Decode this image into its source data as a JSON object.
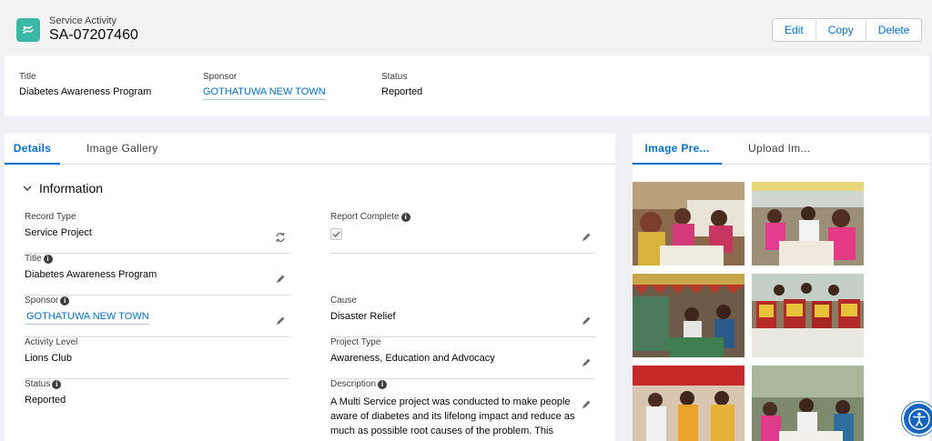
{
  "header": {
    "object_type": "Service Activity",
    "record_name": "SA-07207460",
    "icon": "service-activity-icon",
    "icon_color": "#3bb8a5",
    "buttons": {
      "edit": "Edit",
      "copy": "Copy",
      "delete": "Delete"
    }
  },
  "highlights": {
    "title_label": "Title",
    "title_value": "Diabetes Awareness Program",
    "sponsor_label": "Sponsor",
    "sponsor_value": "GOTHATUWA NEW TOWN",
    "status_label": "Status",
    "status_value": "Reported"
  },
  "details": {
    "tabs": {
      "details": "Details",
      "gallery": "Image Gallery"
    },
    "section": "Information",
    "fields": {
      "record_type": {
        "label": "Record Type",
        "value": "Service Project"
      },
      "report_complete": {
        "label": "Report Complete",
        "checked": true
      },
      "title": {
        "label": "Title",
        "value": "Diabetes Awareness Program"
      },
      "sponsor": {
        "label": "Sponsor",
        "value": "GOTHATUWA NEW TOWN"
      },
      "cause": {
        "label": "Cause",
        "value": "Disaster Relief"
      },
      "activity_level": {
        "label": "Activity Level",
        "value": "Lions Club"
      },
      "project_type": {
        "label": "Project Type",
        "value": "Awareness, Education and Advocacy"
      },
      "status": {
        "label": "Status",
        "value": "Reported"
      },
      "description": {
        "label": "Description",
        "value": "A Multi Service project was conducted to make people aware of diabetes and its lifelong impact and reduce as much as possible root causes of the problem. This"
      }
    }
  },
  "side": {
    "tabs": {
      "preview": "Image Pre...",
      "upload": "Upload Im..."
    }
  },
  "colors": {
    "brand_link": "#0070d2",
    "accessibility_button": "#1565c0"
  }
}
